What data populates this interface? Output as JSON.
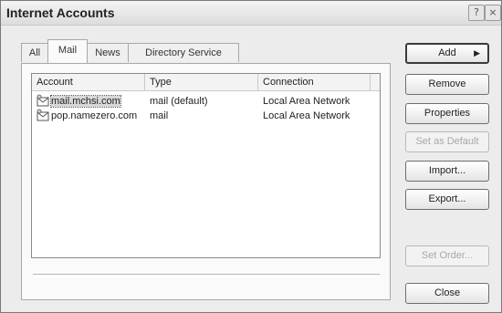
{
  "window": {
    "title": "Internet Accounts"
  },
  "tabs": [
    {
      "label": "All",
      "active": false
    },
    {
      "label": "Mail",
      "active": true
    },
    {
      "label": "News",
      "active": false
    },
    {
      "label": "Directory Service",
      "active": false
    }
  ],
  "list": {
    "columns": [
      "Account",
      "Type",
      "Connection"
    ],
    "rows": [
      {
        "account": "mail.mchsi.com",
        "type": "mail (default)",
        "connection": "Local Area Network",
        "selected": true
      },
      {
        "account": "pop.namezero.com",
        "type": "mail",
        "connection": "Local Area Network",
        "selected": false
      }
    ]
  },
  "buttons": {
    "add": "Add",
    "remove": "Remove",
    "properties": "Properties",
    "set_default": "Set as Default",
    "import": "Import...",
    "export": "Export...",
    "set_order": "Set Order...",
    "close": "Close"
  },
  "icons": {
    "account": "mail-account-icon",
    "help": "help-icon",
    "close": "close-icon",
    "add_arrow": "arrow-right-icon"
  }
}
